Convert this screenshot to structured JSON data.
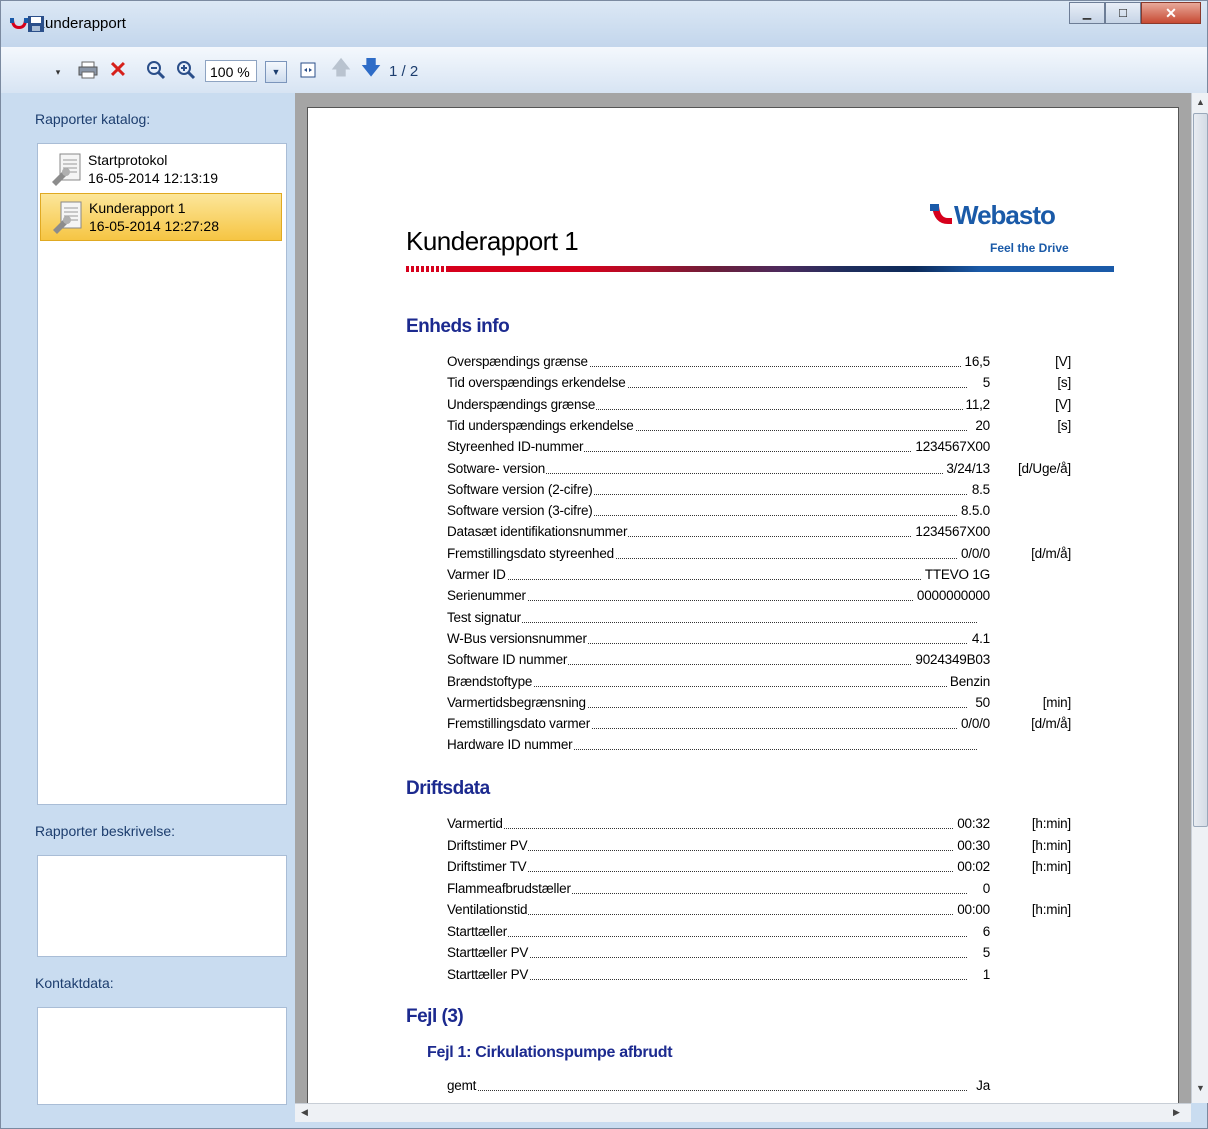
{
  "window": {
    "title": "Kunderapport"
  },
  "toolbar": {
    "zoom_value": "100 %",
    "page_indicator": "1 / 2"
  },
  "left_panel": {
    "catalog_label": "Rapporter katalog:",
    "reports": [
      {
        "name": "Startprotokol",
        "date": "16-05-2014 12:13:19",
        "selected": false
      },
      {
        "name": "Kunderapport 1",
        "date": "16-05-2014 12:27:28",
        "selected": true
      }
    ],
    "description_label": "Rapporter beskrivelse:",
    "contact_label": "Kontaktdata:"
  },
  "report": {
    "title": "Kunderapport 1",
    "logo_text": "Webasto",
    "logo_tagline": "Feel the Drive",
    "unit_info": {
      "heading": "Enheds info",
      "rows": [
        {
          "label": "Overspændings grænse",
          "value": "16,5",
          "unit": "[V]"
        },
        {
          "label": "Tid overspændings erkendelse",
          "value": "5",
          "unit": "[s]"
        },
        {
          "label": "Underspændings grænse",
          "value": "11,2",
          "unit": "[V]"
        },
        {
          "label": "Tid underspændings erkendelse",
          "value": "20",
          "unit": "[s]"
        },
        {
          "label": "Styreenhed ID-nummer",
          "value": "1234567X00",
          "unit": ""
        },
        {
          "label": "Sotware- version",
          "value": "3/24/13",
          "unit": "[d/Uge/å]"
        },
        {
          "label": "Software version (2-cifre)",
          "value": "8.5",
          "unit": ""
        },
        {
          "label": "Software version (3-cifre)",
          "value": "8.5.0",
          "unit": ""
        },
        {
          "label": "Datasæt identifikationsnummer",
          "value": "1234567X00",
          "unit": ""
        },
        {
          "label": "Fremstillingsdato styreenhed",
          "value": "0/0/0",
          "unit": "[d/m/å]"
        },
        {
          "label": "Varmer ID",
          "value": "TTEVO 1G",
          "unit": ""
        },
        {
          "label": "Serienummer",
          "value": "0000000000",
          "unit": ""
        },
        {
          "label": "Test signatur",
          "value": "",
          "unit": ""
        },
        {
          "label": "W-Bus versionsnummer",
          "value": "4.1",
          "unit": ""
        },
        {
          "label": "Software ID nummer",
          "value": "9024349B03",
          "unit": ""
        },
        {
          "label": "Brændstoftype",
          "value": "Benzin",
          "unit": ""
        },
        {
          "label": "Varmertidsbegrænsning",
          "value": "50",
          "unit": "[min]"
        },
        {
          "label": "Fremstillingsdato varmer",
          "value": "0/0/0",
          "unit": "[d/m/å]"
        },
        {
          "label": "Hardware ID nummer",
          "value": "",
          "unit": ""
        }
      ]
    },
    "operating_data": {
      "heading": "Driftsdata",
      "rows": [
        {
          "label": "Varmertid",
          "value": "00:32",
          "unit": "[h:min]"
        },
        {
          "label": "Driftstimer PV",
          "value": "00:30",
          "unit": "[h:min]"
        },
        {
          "label": "Driftstimer TV",
          "value": "00:02",
          "unit": "[h:min]"
        },
        {
          "label": "Flammeafbrudstæller",
          "value": "0",
          "unit": ""
        },
        {
          "label": "Ventilationstid",
          "value": "00:00",
          "unit": "[h:min]"
        },
        {
          "label": "Starttæller",
          "value": "6",
          "unit": ""
        },
        {
          "label": "Starttæller PV",
          "value": "5",
          "unit": ""
        },
        {
          "label": "Starttæller PV",
          "value": "1",
          "unit": ""
        }
      ]
    },
    "errors": {
      "heading": "Fejl (3)",
      "error1_heading": "Fejl 1: Cirkulationspumpe afbrudt",
      "rows": [
        {
          "label": "gemt",
          "value": "Ja",
          "unit": ""
        }
      ]
    }
  },
  "colors": {
    "heading_blue": "#1c2a8f",
    "brand_red": "#d6001c",
    "brand_blue": "#1a5aa8",
    "selection_yellow": "#f6c543"
  }
}
